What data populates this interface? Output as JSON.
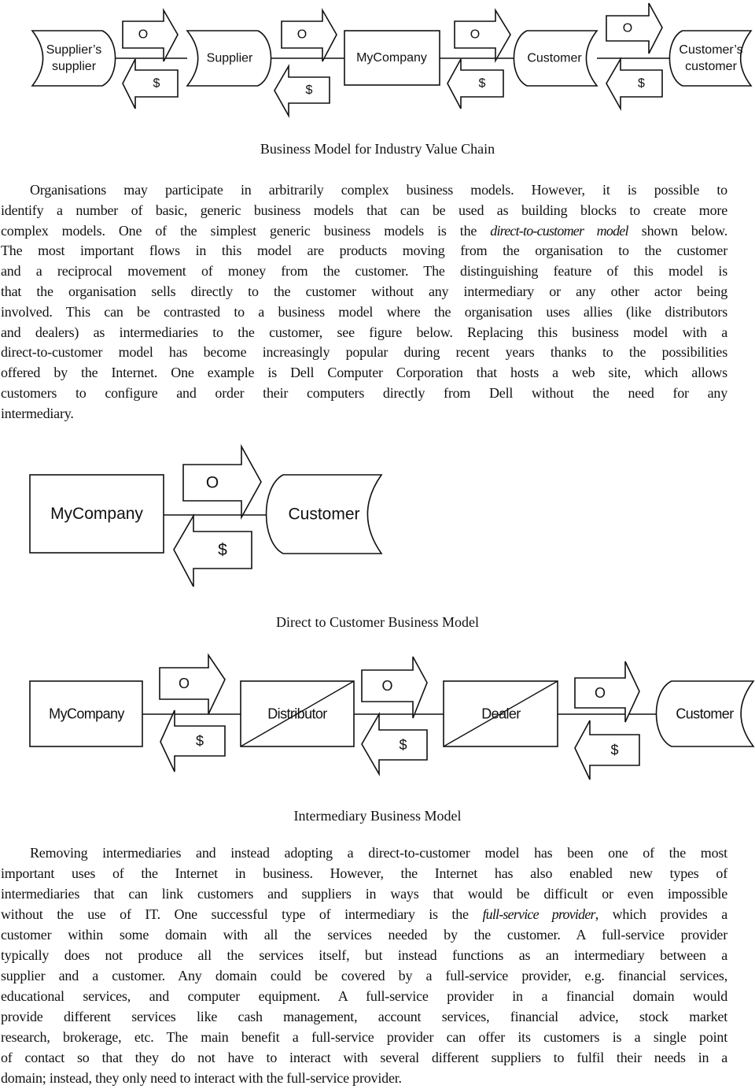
{
  "figures": [
    {
      "id": "value-chain",
      "caption": "Business Model for Industry Value Chain",
      "nodes": [
        {
          "label": [
            "Supplier’s",
            "supplier"
          ],
          "shape": "supplier"
        },
        {
          "label": [
            "Supplier"
          ],
          "shape": "supplier"
        },
        {
          "label": [
            "MyCompany"
          ],
          "shape": "box"
        },
        {
          "label": [
            "Customer"
          ],
          "shape": "customer"
        },
        {
          "label": [
            "Customer’s",
            "customer"
          ],
          "shape": "customer"
        }
      ],
      "product_flow_label": "O",
      "money_flow_label": "$"
    },
    {
      "id": "direct-to-customer",
      "caption": "Direct to Customer Business Model",
      "nodes": [
        {
          "label": [
            "MyCompany"
          ],
          "shape": "box"
        },
        {
          "label": [
            "Customer"
          ],
          "shape": "customer"
        }
      ],
      "product_flow_label": "O",
      "money_flow_label": "$"
    },
    {
      "id": "intermediary",
      "caption": "Intermediary Business Model",
      "nodes": [
        {
          "label": [
            "MyCompany"
          ],
          "shape": "box"
        },
        {
          "label": [
            "Distributor"
          ],
          "shape": "split-box"
        },
        {
          "label": [
            "Dealer"
          ],
          "shape": "split-box"
        },
        {
          "label": [
            "Customer"
          ],
          "shape": "customer"
        }
      ],
      "product_flow_label": "O",
      "money_flow_label": "$"
    }
  ],
  "paragraphs": [
    {
      "lines": [
        "Organisations may participate in arbitrarily complex business models. However, it is possible to",
        "identify a number of basic, generic business models that can be used as building blocks to create more",
        [
          {
            "t": "complex models. One of the simplest generic business models is the "
          },
          {
            "t": "direct-to-customer model",
            "i": true
          },
          {
            "t": " shown below."
          }
        ],
        "The most important flows in this model are products moving from the organisation to the customer",
        "and a reciprocal movement of money from the customer. The distinguishing feature of this model is",
        "that the organisation sells directly to the customer without any intermediary or any other actor being",
        "involved. This can be contrasted to a business model where the organisation uses allies (like distributors",
        "and dealers) as intermediaries to the customer, see figure below. Replacing this business model with a",
        "direct-to-customer model has become increasingly popular during recent years thanks to the possibilities",
        "offered by the Internet. One example is Dell Computer Corporation that hosts a web site, which allows",
        "customers to configure and order their computers directly from Dell without the need for any",
        "intermediary."
      ]
    },
    {
      "lines": [
        "Removing intermediaries and instead adopting a direct-to-customer model has been one of the most",
        "important uses of the Internet in business. However, the Internet has also enabled new types of",
        "intermediaries that can link customers and suppliers in ways that would be difficult or even impossible",
        [
          {
            "t": "without the use of IT. One successful type of intermediary is the "
          },
          {
            "t": "full-service provider",
            "i": true
          },
          {
            "t": ", which provides a"
          }
        ],
        "customer within some domain with all the services needed by the customer. A full-service provider",
        "typically does not produce all the services itself, but instead functions as an intermediary between a",
        "supplier and a customer. Any domain could be covered by a full-service provider, e.g. financial services,",
        "educational services, and computer equipment. A full-service provider in a financial domain would",
        "provide different services like cash management, account services, financial advice, stock market",
        "research, brokerage, etc. The main benefit a full-service provider can offer its customers is a single point",
        "of contact so that they do not have to interact with several different suppliers to fulfil their needs in a",
        "domain; instead, they only need to interact with the full-service provider."
      ]
    }
  ]
}
